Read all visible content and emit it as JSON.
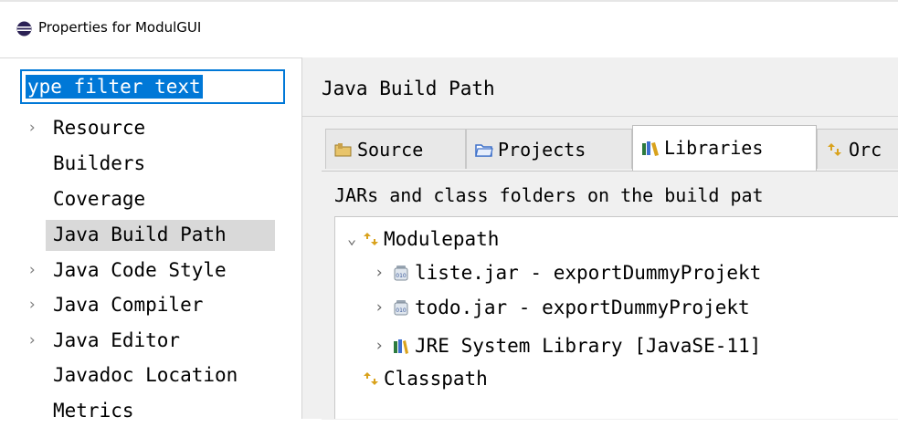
{
  "window": {
    "title": "Properties for ModulGUI",
    "icon": "eclipse-icon"
  },
  "filter": {
    "value": "ype filter text"
  },
  "tree": {
    "items": [
      {
        "label": "Resource",
        "expandable": true,
        "selected": false
      },
      {
        "label": "Builders",
        "expandable": false,
        "selected": false
      },
      {
        "label": "Coverage",
        "expandable": false,
        "selected": false
      },
      {
        "label": "Java Build Path",
        "expandable": false,
        "selected": true
      },
      {
        "label": "Java Code Style",
        "expandable": true,
        "selected": false
      },
      {
        "label": "Java Compiler",
        "expandable": true,
        "selected": false
      },
      {
        "label": "Java Editor",
        "expandable": true,
        "selected": false
      },
      {
        "label": "Javadoc Location",
        "expandable": false,
        "selected": false
      },
      {
        "label": "Metrics",
        "expandable": false,
        "selected": false
      }
    ]
  },
  "page": {
    "title": "Java Build Path",
    "tabs": [
      {
        "label": "Source",
        "icon": "source-folder-icon",
        "active": false
      },
      {
        "label": "Projects",
        "icon": "projects-folder-icon",
        "active": false
      },
      {
        "label": "Libraries",
        "icon": "libraries-icon",
        "active": true
      },
      {
        "label": "Orc",
        "icon": "order-export-icon",
        "active": false
      }
    ],
    "description": "JARs and class folders on the build pat",
    "build_path": {
      "modulepath": {
        "label": "Modulepath",
        "expanded": true,
        "entries": [
          {
            "label": "liste.jar - exportDummyProjekt",
            "icon": "jar-icon"
          },
          {
            "label": "todo.jar - exportDummyProjekt",
            "icon": "jar-icon"
          },
          {
            "label": "JRE System Library [JavaSE-11]",
            "icon": "library-icon"
          }
        ]
      },
      "classpath": {
        "label": "Classpath"
      }
    }
  }
}
